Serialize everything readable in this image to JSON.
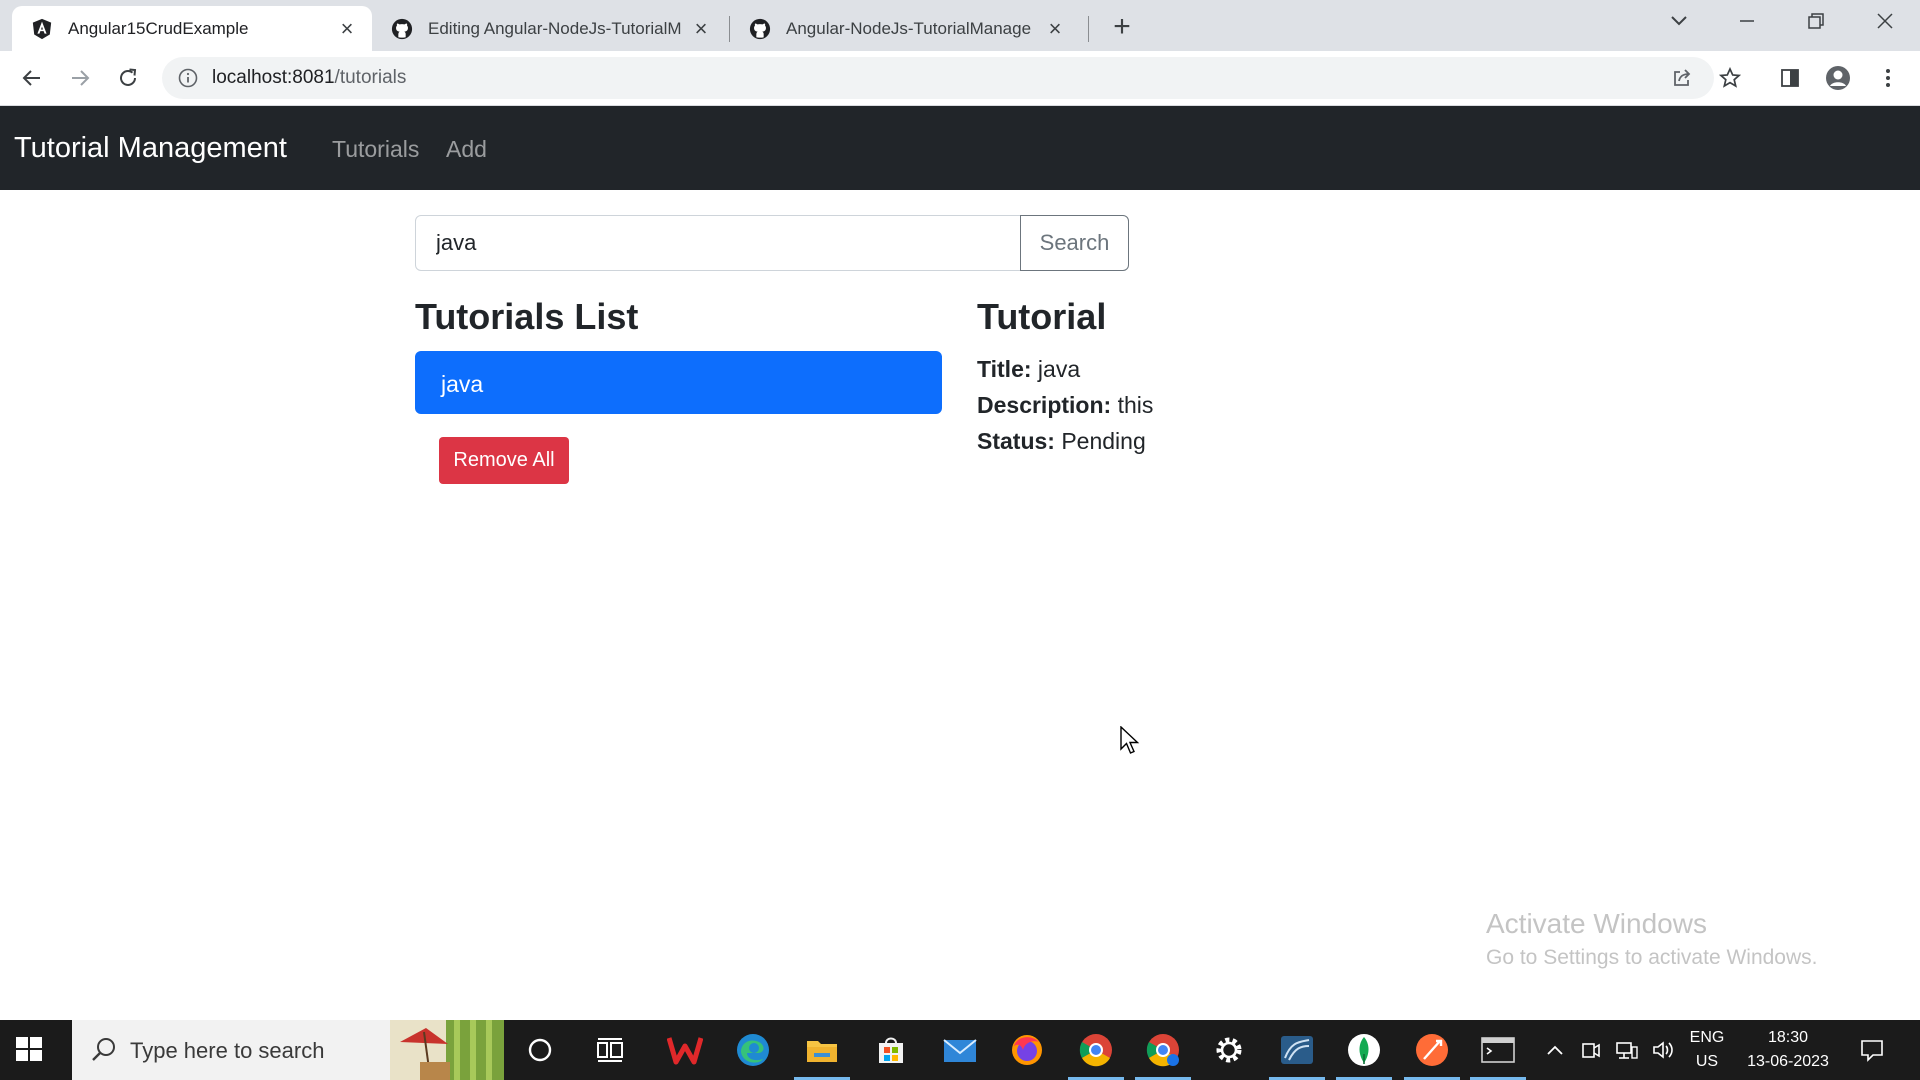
{
  "browser": {
    "tabs": [
      {
        "title": "Angular15CrudExample",
        "favicon": "angular-icon",
        "active": true
      },
      {
        "title": "Editing Angular-NodeJs-TutorialM",
        "favicon": "github-icon",
        "active": false
      },
      {
        "title": "Angular-NodeJs-TutorialManage",
        "favicon": "github-icon",
        "active": false
      }
    ],
    "url_host": "localhost:8081",
    "url_path": "/tutorials"
  },
  "navbar": {
    "brand": "Tutorial Management",
    "links": [
      "Tutorials",
      "Add"
    ]
  },
  "search": {
    "value": "java",
    "button_label": "Search"
  },
  "list": {
    "heading": "Tutorials List",
    "items": [
      "java"
    ],
    "remove_all_label": "Remove All"
  },
  "detail": {
    "heading": "Tutorial",
    "title_label": "Title:",
    "title_value": "java",
    "description_label": "Description:",
    "description_value": "this",
    "status_label": "Status:",
    "status_value": "Pending"
  },
  "watermark": {
    "line1": "Activate Windows",
    "line2": "Go to Settings to activate Windows."
  },
  "taskbar": {
    "search_placeholder": "Type here to search",
    "lang_line1": "ENG",
    "lang_line2": "US",
    "time": "18:30",
    "date": "13-06-2023"
  },
  "colors": {
    "navbar_bg": "#212529",
    "primary": "#0d6efd",
    "danger": "#dc3545",
    "secondary": "#6c757d"
  }
}
